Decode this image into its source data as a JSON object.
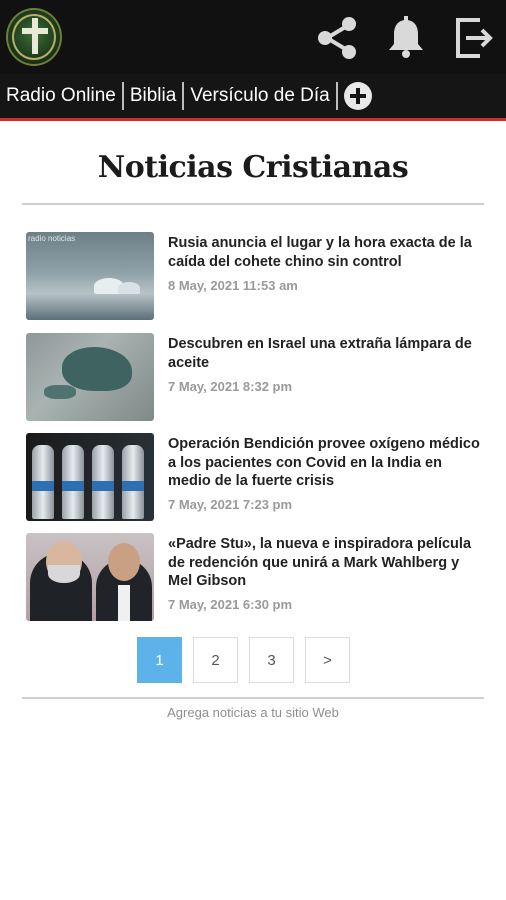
{
  "header": {
    "icons": [
      "logo",
      "share-icon",
      "bell-icon",
      "exit-icon"
    ]
  },
  "nav": {
    "items": [
      "Radio Online",
      "Biblia",
      "Versículo de Día"
    ],
    "add_icon": "plus-circle-icon"
  },
  "page": {
    "title": "Noticias Cristianas"
  },
  "articles": [
    {
      "title": "Rusia anuncia el lugar y la hora exacta de la caída del cohete chino sin control",
      "date": "8 May, 2021 11:53 am",
      "thumb_caption": "radio noticias"
    },
    {
      "title": "Descubren en Israel una extraña lámpara de aceite",
      "date": "7 May, 2021 8:32 pm"
    },
    {
      "title": "Operación Bendición provee oxígeno médico a los pacientes con Covid en la India en medio de la fuerte crisis",
      "date": "7 May, 2021 7:23 pm"
    },
    {
      "title": "«Padre Stu», la nueva e inspiradora película de redención que unirá a Mark Wahlberg y Mel Gibson",
      "date": "7 May, 2021 6:30 pm"
    }
  ],
  "pagination": {
    "pages": [
      "1",
      "2",
      "3"
    ],
    "next": ">",
    "active": "1"
  },
  "footer": {
    "link": "Agrega noticias a tu sitio Web"
  },
  "colors": {
    "topbar": "#111111",
    "accent_line": "#d62a2a",
    "active_page": "#5db2e9"
  }
}
